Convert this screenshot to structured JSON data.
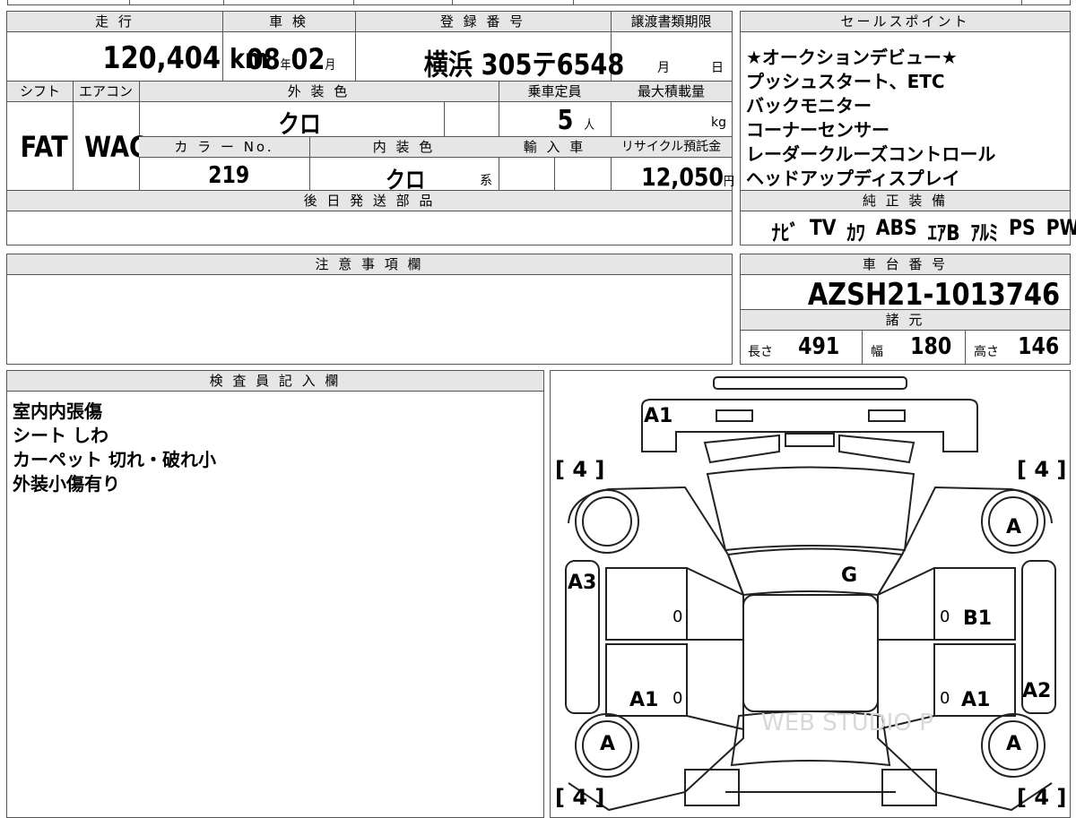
{
  "top_strip": [
    "",
    "",
    "",
    "",
    "",
    ""
  ],
  "main": {
    "mileage_label": "走 行",
    "mileage_value": "120,404",
    "mileage_unit": "km",
    "inspection_label": "車 検",
    "inspection_year": "08",
    "inspection_year_unit": "年",
    "inspection_month": "02",
    "inspection_month_unit": "月",
    "registration_label": "登 録 番 号",
    "registration_value": "横浜 305テ6548",
    "transfer_label": "譲渡書類期限",
    "transfer_month_unit": "月",
    "transfer_day_unit": "日",
    "shift_label": "シフト",
    "shift_value": "FAT",
    "ac_label": "エアコン",
    "ac_value": "WAC",
    "exterior_label": "外 装 色",
    "exterior_value": "クロ",
    "capacity_label": "乗車定員",
    "capacity_value": "5",
    "capacity_unit": "人",
    "maxload_label": "最大積載量",
    "maxload_unit": "kg",
    "color_no_label": "カ ラ ー No.",
    "color_no_value": "219",
    "interior_label": "内 装 色",
    "interior_value": "クロ",
    "interior_suffix": "系",
    "import_label": "輸 入 車",
    "recycle_label": "リサイクル預託金",
    "recycle_value": "12,050",
    "recycle_unit": "円",
    "later_parts_label": "後 日 発 送 部 品"
  },
  "sales": {
    "label": "セールスポイント",
    "points": [
      "★オークションデビュー★",
      "プッシュスタート、ETC",
      "バックモニター",
      "コーナーセンサー",
      "レーダークルーズコントロール",
      "ヘッドアップディスプレイ"
    ]
  },
  "equipment": {
    "label": "純 正 装 備",
    "items": [
      "ﾅﾋﾞ",
      "TV",
      "ｶﾜ",
      "ABS",
      "ｴｱB",
      "ｱﾙﾐ",
      "PS",
      "PW"
    ]
  },
  "caution": {
    "label": "注 意 事 項 欄"
  },
  "chassis": {
    "label": "車 台 番 号",
    "value": "AZSH21-1013746",
    "specs_label": "諸 元",
    "length_label": "長さ",
    "length_value": "491",
    "width_label": "幅",
    "width_value": "180",
    "height_label": "高さ",
    "height_value": "146"
  },
  "inspector": {
    "label": "検 査 員 記 入 欄",
    "notes": [
      "室内内張傷",
      "シート しわ",
      "カーペット 切れ・破れ小",
      "外装小傷有り"
    ]
  },
  "diagram": {
    "tire_bracket": "[ 4 ]",
    "marks": {
      "front_bumper": "A1",
      "windshield": "G",
      "left_front_fender": "A3",
      "right_front_door": "B1",
      "left_rear_door": "A1",
      "right_rear_door": "A1",
      "right_rear_fender": "A2",
      "front_right_wheel": "A",
      "rear_left_wheel": "A",
      "rear_right_wheel": "A",
      "door_zero": "0"
    },
    "watermark": "WEB STUDIO P"
  }
}
